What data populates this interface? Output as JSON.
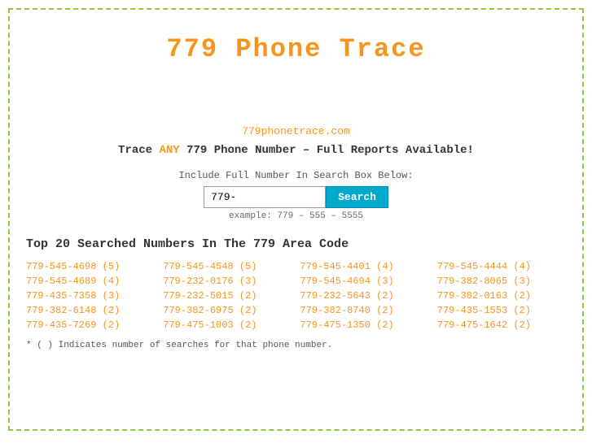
{
  "page": {
    "title": "779 Phone Trace",
    "site_url": "779phonetrace.com",
    "tagline_before": "Trace ",
    "tagline_any": "ANY",
    "tagline_after": " 779 Phone Number – Full Reports Available!",
    "search_label": "Include Full Number In Search Box Below:",
    "search_input_value": "779-",
    "search_button_label": "Search",
    "search_example": "example: 779 – 555 – 5555",
    "section_title": "Top 20 Searched Numbers In The 779 Area Code",
    "footnote": "* ( ) Indicates number of searches for that phone number."
  },
  "numbers": [
    [
      "779-545-4698 (5)",
      "779-545-4548 (5)",
      "779-545-4401 (4)",
      "779-545-4444 (4)"
    ],
    [
      "779-545-4689 (4)",
      "779-232-0176 (3)",
      "779-545-4694 (3)",
      "779-382-8065 (3)"
    ],
    [
      "779-435-7358 (3)",
      "779-232-5015 (2)",
      "779-232-5643 (2)",
      "779-382-0163 (2)"
    ],
    [
      "779-382-6148 (2)",
      "779-382-6975 (2)",
      "779-382-8740 (2)",
      "779-435-1553 (2)"
    ],
    [
      "779-435-7269 (2)",
      "779-475-1003 (2)",
      "779-475-1350 (2)",
      "779-475-1642 (2)"
    ]
  ],
  "colors": {
    "title": "#f7941d",
    "link": "#f7941d",
    "button_bg": "#00aacc",
    "border": "#8dc63f"
  }
}
